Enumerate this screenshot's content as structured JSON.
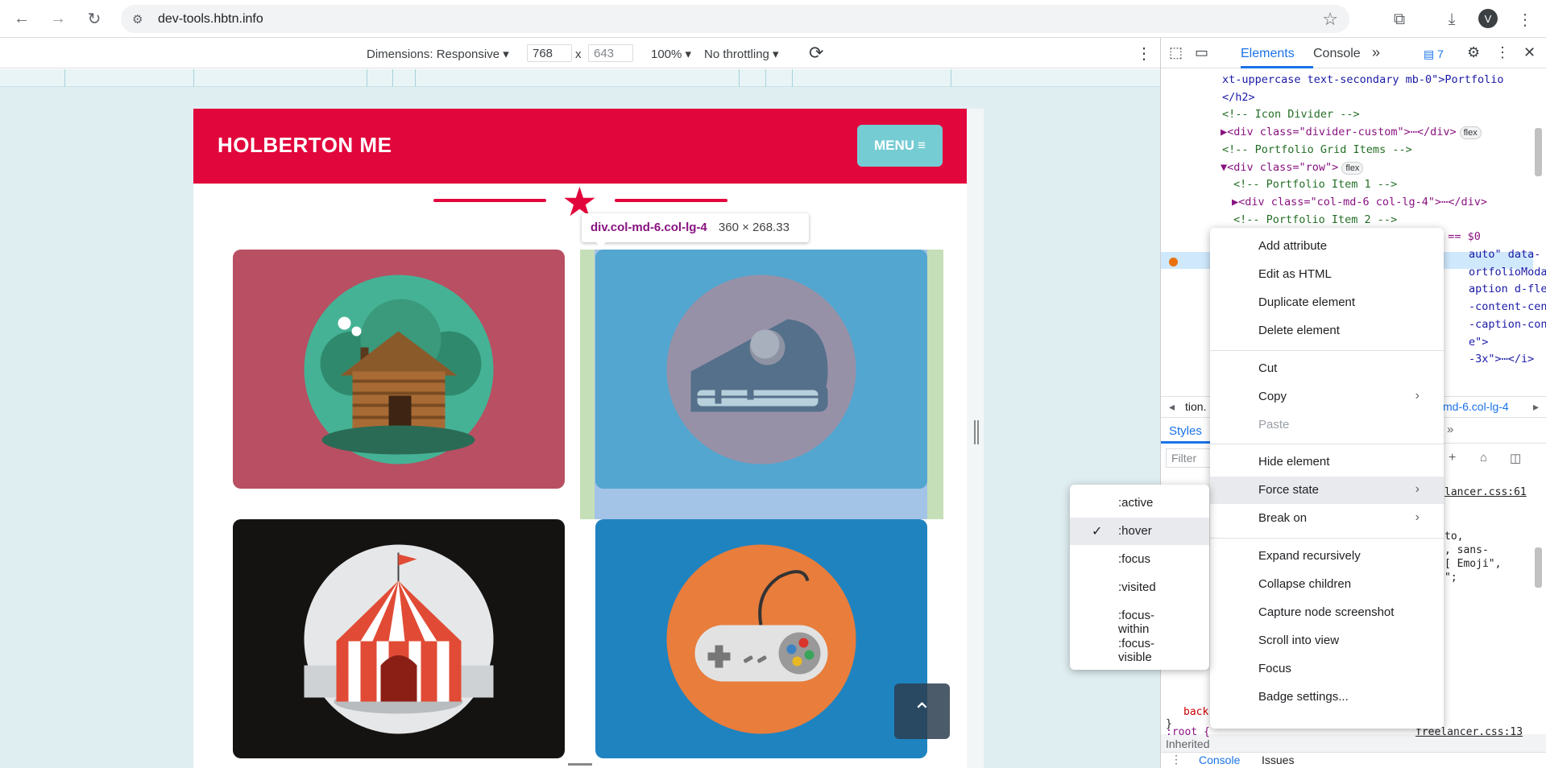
{
  "browser": {
    "url": "dev-tools.hbtn.info",
    "avatar_letter": "V"
  },
  "device_toolbar": {
    "dimensions_label": "Dimensions: Responsive ▾",
    "width": "768",
    "times": "x",
    "height": "643",
    "zoom": "100% ▾",
    "throttling": "No throttling ▾"
  },
  "page": {
    "brand": "HOLBERTON ME",
    "menu_label": "MENU",
    "tooltip_tag": "div.col-md-6.col-lg-4",
    "tooltip_dims": "360 × 268.33",
    "cards": [
      {
        "name": "cabin",
        "bg": "#b84f62",
        "circle": "#46b295"
      },
      {
        "name": "cake",
        "bg": "#52a6cf",
        "circle": "#9791a8"
      },
      {
        "name": "circus",
        "bg": "#151312",
        "circle": "#e6e7e8"
      },
      {
        "name": "game",
        "bg": "#1f83c0",
        "circle": "#e87d3c"
      }
    ]
  },
  "devtools": {
    "tabs": [
      "Elements",
      "Console"
    ],
    "more_tabs": "»",
    "issues_count": "7",
    "dom_lines": [
      {
        "type": "text",
        "text": "xt-uppercase text-secondary mb-0\">Portfolio"
      },
      {
        "type": "text",
        "text": "</h2>"
      },
      {
        "type": "comment",
        "text": "<!-- Icon Divider -->"
      },
      {
        "type": "node",
        "text": "▶<div class=\"divider-custom\">⋯</div>",
        "badge": "flex"
      },
      {
        "type": "comment",
        "text": "<!-- Portfolio Grid Items -->"
      },
      {
        "type": "node",
        "text": "▼<div class=\"row\">",
        "badge": "flex"
      },
      {
        "type": "comment",
        "text": "<!-- Portfolio Item 1 -->"
      },
      {
        "type": "node",
        "text": "▶<div class=\"col-md-6 col-lg-4\">⋯</div>",
        "badge": ""
      },
      {
        "type": "comment",
        "text": "<!-- Portfolio Item 2 -->"
      },
      {
        "type": "selected",
        "text": "▼<div class=\"col-md-6 col-lg-4\"> == $0"
      },
      {
        "type": "text",
        "text": "auto\" data-"
      },
      {
        "type": "text",
        "text": "ortfolioModa"
      },
      {
        "type": "text",
        "text": "aption d-fle"
      },
      {
        "type": "text",
        "text": "-content-cen"
      },
      {
        "type": "text",
        "text": "-caption-con"
      },
      {
        "type": "text",
        "text": "e\">"
      },
      {
        "type": "text",
        "text": "-3x\">⋯</i>"
      }
    ],
    "breadcrumb_left": "tion.",
    "breadcrumb_right": "md-6.col-lg-4",
    "styles_tab": "Styles",
    "filter_placeholder": "Filter",
    "styles_source": "lancer.css:61",
    "style_fragments": [
      "to,",
      ", sans-",
      "[ Emoji\",",
      "\";"
    ],
    "inherited_label": "Inherited",
    "root_selector": ":root {",
    "root_source": "freelancer.css:13",
    "close_brace": "}",
    "back_text": "back",
    "bottom_tabs": [
      "Console",
      "Issues"
    ]
  },
  "context_menu": {
    "items": [
      {
        "label": "Add attribute"
      },
      {
        "label": "Edit as HTML"
      },
      {
        "label": "Duplicate element"
      },
      {
        "label": "Delete element"
      },
      {
        "label": "Cut"
      },
      {
        "label": "Copy",
        "submenu": true
      },
      {
        "label": "Paste",
        "disabled": true
      },
      {
        "label": "Hide element"
      },
      {
        "label": "Force state",
        "submenu": true,
        "hover": true
      },
      {
        "label": "Break on",
        "submenu": true
      },
      {
        "label": "Expand recursively"
      },
      {
        "label": "Collapse children"
      },
      {
        "label": "Capture node screenshot"
      },
      {
        "label": "Scroll into view"
      },
      {
        "label": "Focus"
      },
      {
        "label": "Badge settings..."
      }
    ]
  },
  "force_state_menu": {
    "items": [
      {
        "label": ":active"
      },
      {
        "label": ":hover",
        "checked": true
      },
      {
        "label": ":focus"
      },
      {
        "label": ":visited"
      },
      {
        "label": ":focus-within"
      },
      {
        "label": ":focus-visible"
      }
    ]
  },
  "colors": {
    "brand_red": "#e1063c",
    "menu_teal": "#76ccd3",
    "devtools_blue": "#1a73e8"
  }
}
